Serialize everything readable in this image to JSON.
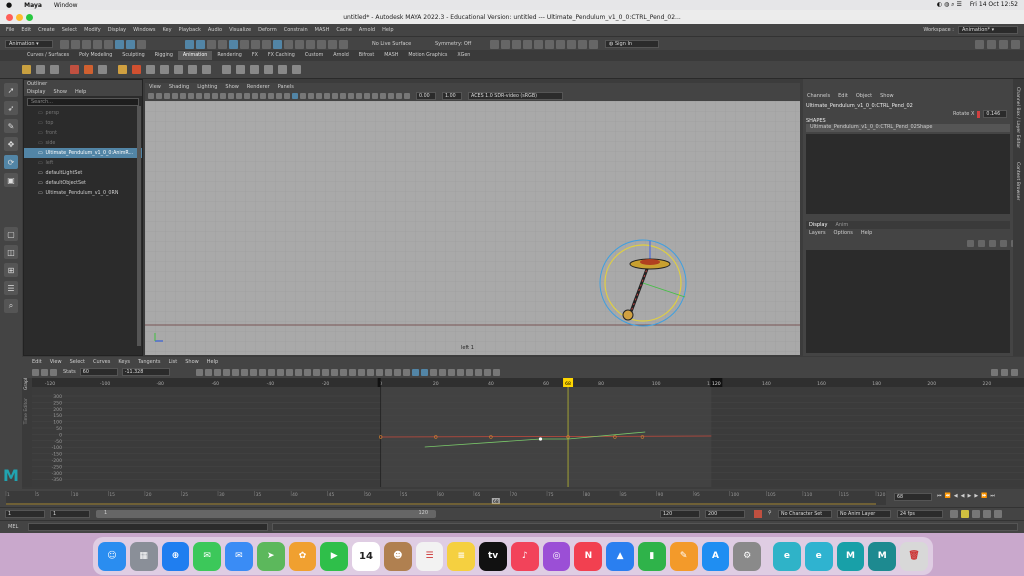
{
  "mac": {
    "apple": "",
    "app": "Maya",
    "window": "Window",
    "date": "Fri 14 Oct 12:52"
  },
  "title": "untitled* - Autodesk MAYA 2022.3 - Educational Version: untitled  ---  Ultimate_Pendulum_v1_0_0:CTRL_Pend_02...",
  "menu": {
    "items": [
      "File",
      "Edit",
      "Create",
      "Select",
      "Modify",
      "Display",
      "Windows",
      "Key",
      "Playback",
      "Audio",
      "Visualize",
      "Deform",
      "Constrain",
      "MASH",
      "Cache",
      "Arnold",
      "Help"
    ],
    "workspace_label": "Workspace :",
    "workspace_value": "Animation*"
  },
  "status": {
    "mode": "Animation",
    "live_surface": "No Live Surface",
    "symmetry": "Symmetry: Off",
    "sign_in": "Sign In"
  },
  "shelf_tabs": [
    "Curves / Surfaces",
    "Poly Modeling",
    "Sculpting",
    "Rigging",
    "Animation",
    "Rendering",
    "FX",
    "FX Caching",
    "Custom",
    "Arnold",
    "Bifrost",
    "MASH",
    "Motion Graphics",
    "XGen"
  ],
  "shelf_active": "Animation",
  "outliner": {
    "title": "Outliner",
    "menu": [
      "Display",
      "Show",
      "Help"
    ],
    "search_placeholder": "Search...",
    "items": [
      {
        "label": "persp",
        "state": "dim"
      },
      {
        "label": "top",
        "state": "dim"
      },
      {
        "label": "front",
        "state": "dim"
      },
      {
        "label": "side",
        "state": "dim"
      },
      {
        "label": "Ultimate_Pendulum_v1_0_0:AnimR...",
        "state": "sel"
      },
      {
        "label": "left",
        "state": "dim"
      },
      {
        "label": "defaultLightSet",
        "state": "normal"
      },
      {
        "label": "defaultObjectSet",
        "state": "normal"
      },
      {
        "label": "Ultimate_Pendulum_v1_0_0RN",
        "state": "normal"
      }
    ]
  },
  "viewport": {
    "menu": [
      "View",
      "Shading",
      "Lighting",
      "Show",
      "Renderer",
      "Panels"
    ],
    "exposure": "0.00",
    "gamma": "1.00",
    "colorspace": "ACES 1.0 SDR-video (sRGB)",
    "camera_label": "left 1"
  },
  "channelbox": {
    "menu": [
      "Channels",
      "Edit",
      "Object",
      "Show"
    ],
    "node": "Ultimate_Pendulum_v1_0_0:CTRL_Pend_02",
    "attr_label": "Rotate X",
    "attr_value": "0.146",
    "shapes_label": "SHAPES",
    "shape_node": "Ultimate_Pendulum_v1_0_0:CTRL_Pend_02Shape",
    "layer_tabs": [
      "Display",
      "Anim"
    ],
    "layer_menu": [
      "Layers",
      "Options",
      "Help"
    ],
    "side_tabs": [
      "Channel Box / Layer Editor",
      "Content Browser"
    ]
  },
  "graph": {
    "menu": [
      "Edit",
      "View",
      "Select",
      "Curves",
      "Keys",
      "Tangents",
      "List",
      "Show",
      "Help"
    ],
    "stats_label": "Stats",
    "stats_frame": "60",
    "stats_value": "-11.328",
    "ruler_ticks": [
      "-120",
      "-100",
      "-80",
      "-60",
      "-40",
      "-20",
      "0",
      "20",
      "40",
      "60",
      "80",
      "100",
      "120",
      "140",
      "160",
      "180",
      "200",
      "220"
    ],
    "current_frame_tag": "68",
    "range_end_tag": "120",
    "y_ticks": [
      "300",
      "250",
      "200",
      "150",
      "100",
      "50",
      "0",
      "-50",
      "-100",
      "-150",
      "-200",
      "-250",
      "-300",
      "-350"
    ],
    "side_label_1": "Graph Editor",
    "side_label_2": "Time Editor"
  },
  "timeline": {
    "ticks": [
      "1",
      "5",
      "10",
      "15",
      "20",
      "25",
      "30",
      "35",
      "40",
      "45",
      "50",
      "55",
      "60",
      "65",
      "70",
      "75",
      "80",
      "85",
      "90",
      "95",
      "100",
      "105",
      "110",
      "115",
      "120"
    ],
    "current_frame": "68"
  },
  "range": {
    "start": "1",
    "start2": "1",
    "slider_start": "1",
    "slider_end": "120",
    "end": "120",
    "end2": "200",
    "char_set": "No Character Set",
    "anim_layer": "No Anim Layer",
    "fps": "24 fps"
  },
  "mel": {
    "label": "MEL"
  },
  "dock": [
    {
      "name": "finder",
      "glyph": "☺",
      "color": "#2a8df0"
    },
    {
      "name": "launchpad",
      "glyph": "▦",
      "color": "#8a8f98"
    },
    {
      "name": "safari",
      "glyph": "⊕",
      "color": "#1f7ef0"
    },
    {
      "name": "messages",
      "glyph": "✉",
      "color": "#3cc85a"
    },
    {
      "name": "mail",
      "glyph": "✉",
      "color": "#3a8cf5"
    },
    {
      "name": "maps",
      "glyph": "➤",
      "color": "#5cb85c"
    },
    {
      "name": "photos",
      "glyph": "✿",
      "color": "#f0a030"
    },
    {
      "name": "facetime",
      "glyph": "▶",
      "color": "#2fbf4a"
    },
    {
      "name": "calendar",
      "glyph": "14",
      "color": "#ffffff"
    },
    {
      "name": "contacts",
      "glyph": "☻",
      "color": "#b08050"
    },
    {
      "name": "reminders",
      "glyph": "☰",
      "color": "#f2f2f2"
    },
    {
      "name": "notes",
      "glyph": "≡",
      "color": "#f5d040"
    },
    {
      "name": "tv",
      "glyph": "tv",
      "color": "#111111"
    },
    {
      "name": "music",
      "glyph": "♪",
      "color": "#f2435a"
    },
    {
      "name": "podcasts",
      "glyph": "◎",
      "color": "#9b4fd6"
    },
    {
      "name": "news",
      "glyph": "N",
      "color": "#f24050"
    },
    {
      "name": "keynote",
      "glyph": "▲",
      "color": "#2a7ff0"
    },
    {
      "name": "numbers",
      "glyph": "▮",
      "color": "#2fb34a"
    },
    {
      "name": "pages",
      "glyph": "✎",
      "color": "#f39a2a"
    },
    {
      "name": "appstore",
      "glyph": "A",
      "color": "#1f8ef2"
    },
    {
      "name": "system-preferences",
      "glyph": "⚙",
      "color": "#8a8a8a"
    },
    {
      "name": "app-e1",
      "glyph": "e",
      "color": "#2fb3c8"
    },
    {
      "name": "app-e2",
      "glyph": "e",
      "color": "#2fb3d0"
    },
    {
      "name": "maya",
      "glyph": "M",
      "color": "#18a0a8"
    },
    {
      "name": "maya-2",
      "glyph": "M",
      "color": "#1d8a90"
    },
    {
      "name": "trash",
      "glyph": "🗑",
      "color": "#d8d8d8"
    }
  ],
  "colors": {
    "accent": "#5285a6",
    "active_key": "#ffd600",
    "red_curve": "#c84a3c",
    "green_curve": "#7ac86a"
  }
}
